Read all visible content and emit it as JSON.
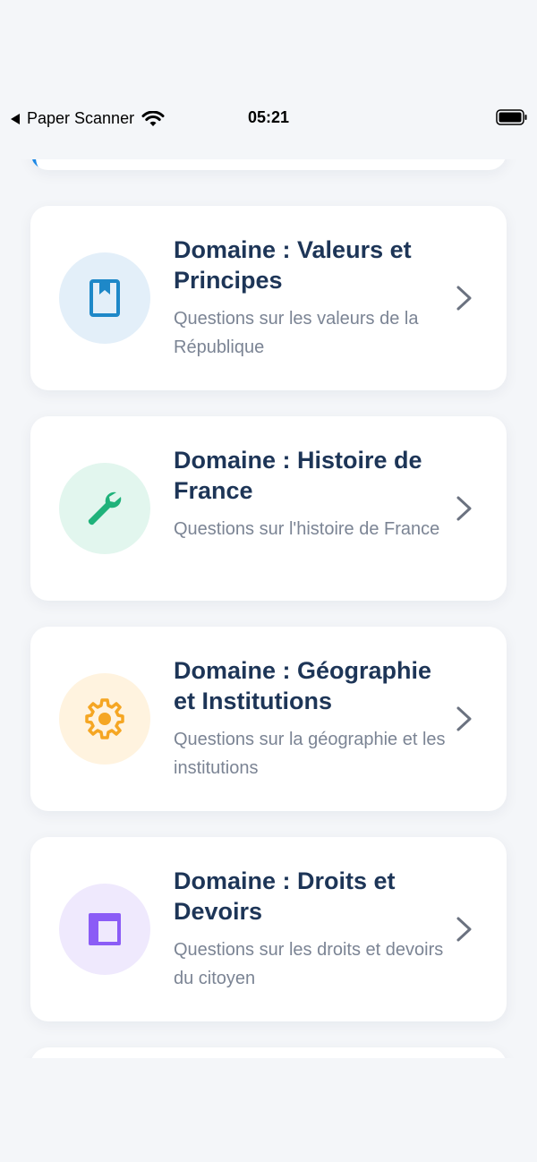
{
  "status_bar": {
    "back_app": "Paper Scanner",
    "time": "05:21"
  },
  "domains": [
    {
      "title": "Domaine : Valeurs et Principes",
      "description": "Questions sur les valeurs de la République",
      "icon": "book-icon",
      "icon_color": "#1e88c8",
      "circle_color": "#e3eff9"
    },
    {
      "title": "Domaine : Histoire de France",
      "description": "Questions sur l'histoire de France",
      "icon": "wrench-icon",
      "icon_color": "#1fb27a",
      "circle_color": "#e2f6ee"
    },
    {
      "title": "Domaine : Géographie et Institutions",
      "description": "Questions sur la géographie et les institutions",
      "icon": "gear-icon",
      "icon_color": "#f5a623",
      "circle_color": "#fff3df"
    },
    {
      "title": "Domaine : Droits et Devoirs",
      "description": "Questions sur les droits et devoirs du citoyen",
      "icon": "layout-icon",
      "icon_color": "#8b5cf6",
      "circle_color": "#efe9fd"
    }
  ]
}
